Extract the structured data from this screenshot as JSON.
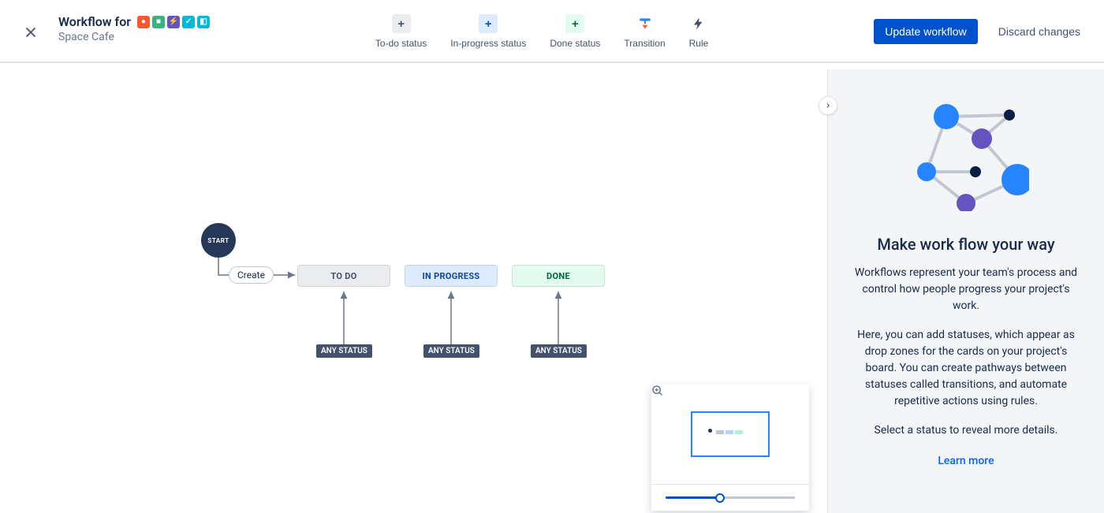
{
  "header": {
    "title_prefix": "Workflow for",
    "subtitle": "Space Cafe"
  },
  "toolbar": {
    "todo_status": "To-do status",
    "inprogress_status": "In-progress status",
    "done_status": "Done status",
    "transition": "Transition",
    "rule": "Rule"
  },
  "actions": {
    "update": "Update workflow",
    "discard": "Discard changes"
  },
  "canvas": {
    "start": "START",
    "create": "Create",
    "todo": "TO DO",
    "in_progress": "IN PROGRESS",
    "done": "DONE",
    "any_status": "ANY STATUS"
  },
  "panel": {
    "title": "Make work flow your way",
    "paragraph1": "Workflows represent your team's process and control how people progress your project's work.",
    "paragraph2": "Here, you can add statuses, which appear as drop zones for the cards on your project's board. You can create pathways between statuses called transitions, and automate repetitive actions using rules.",
    "paragraph3": "Select a status to reveal more details.",
    "learn_more": "Learn more"
  }
}
